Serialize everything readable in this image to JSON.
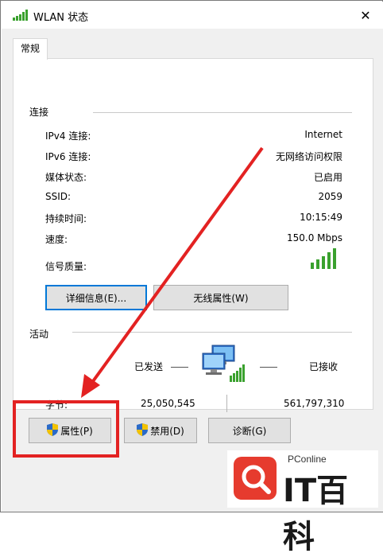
{
  "window": {
    "title": "WLAN 状态",
    "close_glyph": "✕"
  },
  "tabs": [
    {
      "label": "常规"
    }
  ],
  "connection": {
    "group_title": "连接",
    "rows": [
      {
        "label": "IPv4 连接:",
        "value": "Internet"
      },
      {
        "label": "IPv6 连接:",
        "value": "无网络访问权限"
      },
      {
        "label": "媒体状态:",
        "value": "已启用"
      },
      {
        "label": "SSID:",
        "value": "2059"
      },
      {
        "label": "持续时间:",
        "value": "10:15:49"
      },
      {
        "label": "速度:",
        "value": "150.0 Mbps"
      }
    ],
    "signal_label": "信号质量:",
    "signal_bars": 5,
    "details_button": "详细信息(E)...",
    "wireless_button": "无线属性(W)"
  },
  "activity": {
    "group_title": "活动",
    "sent_label": "已发送",
    "received_label": "已接收",
    "bytes_label": "字节:",
    "sent_bytes": "25,050,545",
    "received_bytes": "561,797,310"
  },
  "footer_buttons": {
    "properties": "属性(P)",
    "disable": "禁用(D)",
    "diagnose": "诊断(G)"
  },
  "watermark": {
    "small": "PConline",
    "big": "IT百科"
  },
  "colors": {
    "highlight_box": "#e32222",
    "arrow": "#e32222",
    "focus": "#0078d7",
    "signal": "#3aa12e",
    "shield_blue": "#2a6ac8",
    "shield_yellow": "#f2c200"
  }
}
